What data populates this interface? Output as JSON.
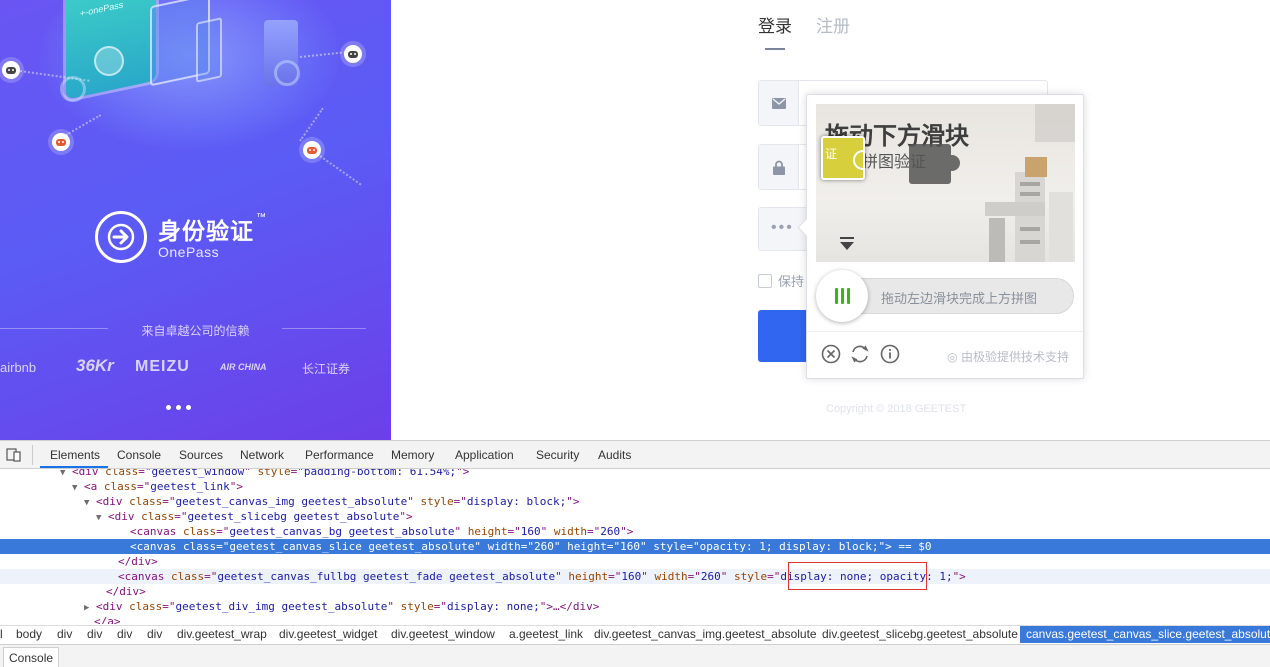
{
  "banner": {
    "title": "身份验证",
    "trademark": "™",
    "subtitle": "OnePass",
    "phone_tag": "+-onePass",
    "trust_text": "来自卓越公司的信赖",
    "partners": [
      "airbnb",
      "36Kr",
      "MEIZU",
      "AIR CHINA",
      "长江证券"
    ],
    "carousel_count": 3
  },
  "login": {
    "tabs": [
      {
        "label": "登录",
        "active": true
      },
      {
        "label": "注册",
        "active": false
      }
    ],
    "captcha_trigger_text": "•••",
    "remember_label": "保持",
    "copyright": "Copyright © 2018 GEETEST"
  },
  "captcha": {
    "image_title": "拖动下方滑块",
    "image_subtitle": "拼图验证",
    "piece_text": "证",
    "slider_hint": "拖动左边滑块完成上方拼图",
    "brand": "由极验提供技术支持",
    "tools": [
      "close",
      "refresh",
      "info"
    ]
  },
  "devtools": {
    "tabs": [
      "Elements",
      "Console",
      "Sources",
      "Network",
      "Performance",
      "Memory",
      "Application",
      "Security",
      "Audits"
    ],
    "active_tab": "Elements",
    "lines": [
      {
        "tw": "▼",
        "parts": [
          [
            "tg",
            "<div "
          ],
          [
            "an",
            "class"
          ],
          [
            "tg",
            "=\""
          ],
          [
            "av",
            "geetest_window"
          ],
          [
            "tg",
            "\" "
          ],
          [
            "an",
            "style"
          ],
          [
            "tg",
            "=\""
          ],
          [
            "av",
            "padding-bottom: 61.54%;"
          ],
          [
            "tg",
            "\">"
          ]
        ]
      },
      {
        "tw": "▼",
        "parts": [
          [
            "tg",
            "<a "
          ],
          [
            "an",
            "class"
          ],
          [
            "tg",
            "=\""
          ],
          [
            "av",
            "geetest_link"
          ],
          [
            "tg",
            "\">"
          ]
        ]
      },
      {
        "tw": "▼",
        "parts": [
          [
            "tg",
            "<div "
          ],
          [
            "an",
            "class"
          ],
          [
            "tg",
            "=\""
          ],
          [
            "av",
            "geetest_canvas_img geetest_absolute"
          ],
          [
            "tg",
            "\" "
          ],
          [
            "an",
            "style"
          ],
          [
            "tg",
            "=\""
          ],
          [
            "av",
            "display: block;"
          ],
          [
            "tg",
            "\">"
          ]
        ]
      },
      {
        "tw": "▼",
        "parts": [
          [
            "tg",
            "<div "
          ],
          [
            "an",
            "class"
          ],
          [
            "tg",
            "=\""
          ],
          [
            "av",
            "geetest_slicebg geetest_absolute"
          ],
          [
            "tg",
            "\">"
          ]
        ]
      },
      {
        "tw": "",
        "parts": [
          [
            "tg",
            "<canvas "
          ],
          [
            "an",
            "class"
          ],
          [
            "tg",
            "=\""
          ],
          [
            "av",
            "geetest_canvas_bg geetest_absolute"
          ],
          [
            "tg",
            "\" "
          ],
          [
            "an",
            "height"
          ],
          [
            "tg",
            "=\""
          ],
          [
            "av",
            "160"
          ],
          [
            "tg",
            "\" "
          ],
          [
            "an",
            "width"
          ],
          [
            "tg",
            "=\""
          ],
          [
            "av",
            "260"
          ],
          [
            "tg",
            "\">"
          ]
        ]
      },
      {
        "tw": "",
        "parts": [
          [
            "tg",
            "<canvas "
          ],
          [
            "an",
            "class"
          ],
          [
            "tg",
            "=\""
          ],
          [
            "av",
            "geetest_canvas_slice geetest_absolute"
          ],
          [
            "tg",
            "\" "
          ],
          [
            "an",
            "width"
          ],
          [
            "tg",
            "=\""
          ],
          [
            "av",
            "260"
          ],
          [
            "tg",
            "\" "
          ],
          [
            "an",
            "height"
          ],
          [
            "tg",
            "=\""
          ],
          [
            "av",
            "160"
          ],
          [
            "tg",
            "\" "
          ],
          [
            "an",
            "style"
          ],
          [
            "tg",
            "=\""
          ],
          [
            "av",
            "opacity: 1; display: block;"
          ],
          [
            "tg",
            "\">"
          ],
          [
            "tx",
            " == $0"
          ]
        ]
      },
      {
        "tw": "",
        "parts": [
          [
            "tg",
            "</div>"
          ]
        ]
      },
      {
        "tw": "",
        "parts": [
          [
            "tg",
            "<canvas "
          ],
          [
            "an",
            "class"
          ],
          [
            "tg",
            "=\""
          ],
          [
            "av",
            "geetest_canvas_fullbg geetest_fade geetest_absolute"
          ],
          [
            "tg",
            "\" "
          ],
          [
            "an",
            "height"
          ],
          [
            "tg",
            "=\""
          ],
          [
            "av",
            "160"
          ],
          [
            "tg",
            "\" "
          ],
          [
            "an",
            "width"
          ],
          [
            "tg",
            "=\""
          ],
          [
            "av",
            "260"
          ],
          [
            "tg",
            "\" "
          ],
          [
            "an",
            "style"
          ],
          [
            "tg",
            "=\""
          ],
          [
            "av",
            "display: none; opacity: 1;"
          ],
          [
            "tg",
            "\">"
          ]
        ]
      },
      {
        "tw": "",
        "parts": [
          [
            "tg",
            "</div>"
          ]
        ]
      },
      {
        "tw": "▶",
        "parts": [
          [
            "tg",
            "<div "
          ],
          [
            "an",
            "class"
          ],
          [
            "tg",
            "=\""
          ],
          [
            "av",
            "geetest_div_img geetest_absolute"
          ],
          [
            "tg",
            "\" "
          ],
          [
            "an",
            "style"
          ],
          [
            "tg",
            "=\""
          ],
          [
            "av",
            "display: none;"
          ],
          [
            "tg",
            "\">…</div>"
          ]
        ]
      },
      {
        "tw": "",
        "parts": [
          [
            "tg",
            "</a>"
          ]
        ]
      }
    ],
    "breadcrumbs": [
      "l",
      "body",
      "div",
      "div",
      "div",
      "div",
      "div.geetest_wrap",
      "div.geetest_widget",
      "div.geetest_window",
      "a.geetest_link",
      "div.geetest_canvas_img.geetest_absolute",
      "div.geetest_slicebg.geetest_absolute",
      "canvas.geetest_canvas_slice.geetest_absolute"
    ],
    "active_breadcrumb": 12,
    "drawer_tab": "Console"
  }
}
